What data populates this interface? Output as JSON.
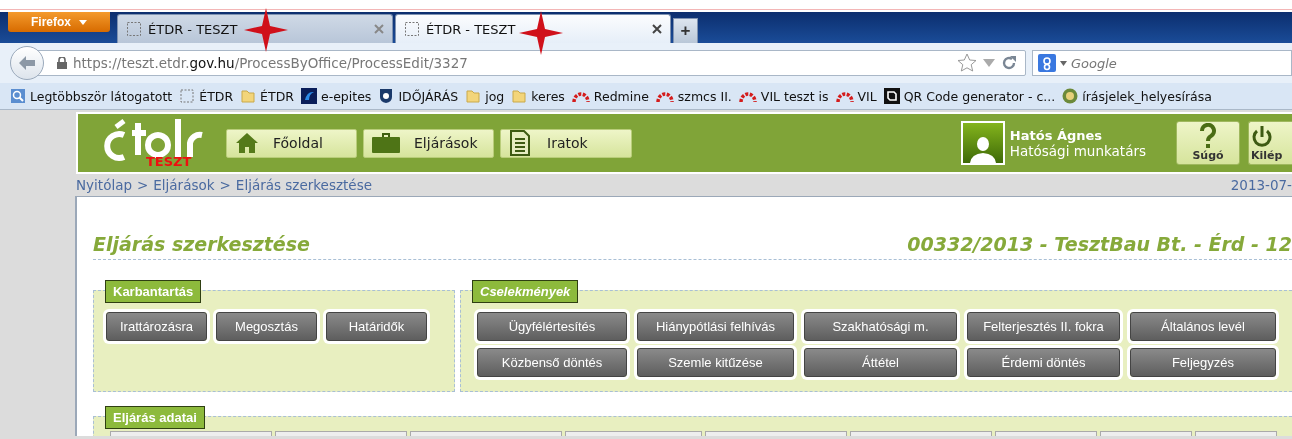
{
  "browser": {
    "menu_button": "Firefox",
    "tabs": [
      {
        "title": "ÉTDR - TESZT",
        "selected": false
      },
      {
        "title": "ÉTDR - TESZT",
        "selected": true
      }
    ],
    "new_tab": "+",
    "address": {
      "prefix": "https://teszt.etdr.",
      "domain": "gov.hu",
      "path": "/ProcessByOffice/ProcessEdit/3327"
    },
    "search": {
      "placeholder": "Google"
    },
    "bookmarks": [
      {
        "label": "Legtöbbször látogatott",
        "kind": "smart"
      },
      {
        "label": "ÉTDR",
        "kind": "page"
      },
      {
        "label": "ÉTDR",
        "kind": "folder"
      },
      {
        "label": "e-epites",
        "kind": "app"
      },
      {
        "label": "IDŐJÁRÁS",
        "kind": "shield"
      },
      {
        "label": "jog",
        "kind": "folder"
      },
      {
        "label": "keres",
        "kind": "folder"
      },
      {
        "label": "Redmine",
        "kind": "redmine"
      },
      {
        "label": "szmcs II.",
        "kind": "redmine"
      },
      {
        "label": "VIL teszt is",
        "kind": "redmine"
      },
      {
        "label": "VIL",
        "kind": "redmine"
      },
      {
        "label": "QR Code generator - c...",
        "kind": "qr"
      },
      {
        "label": "írásjelek_helyesírása",
        "kind": "emblem"
      }
    ]
  },
  "header": {
    "logo_badge": "TESZT",
    "nav": [
      {
        "label": "Főoldal",
        "kind": "home"
      },
      {
        "label": "Eljárások",
        "kind": "briefcase"
      },
      {
        "label": "Iratok",
        "kind": "document"
      }
    ],
    "user": {
      "name": "Hatós Ágnes",
      "role": "Hatósági munkatárs"
    },
    "actions": [
      {
        "label": "Súgó",
        "kind": "help"
      },
      {
        "label": "Kilép",
        "kind": "power"
      }
    ]
  },
  "breadcrumb": [
    {
      "label": "Nyitólap",
      "separator": ">"
    },
    {
      "label": "Eljárások",
      "separator": ">"
    },
    {
      "label": "Eljárás szerkesztése"
    }
  ],
  "date": "2013-07-",
  "page_title": "Eljárás szerkesztése",
  "case_title": "00332/2013 - TesztBau Bt. - Érd - 12",
  "panels": [
    {
      "legend": "Karbantartás",
      "buttons": [
        "Irattározásra",
        "Megosztás",
        "Határidők"
      ]
    },
    {
      "legend": "Cselekmények",
      "buttons": [
        "Ügyfélértesítés",
        "Hiánypótlási felhívás",
        "Szakhatósági m.",
        "Felterjesztés II. fokra",
        "Általános levél",
        "Közbenső döntés",
        "Szemle kitűzése",
        "Áttétel",
        "Érdemi döntés",
        "Feljegyzés"
      ]
    }
  ],
  "data_panel": {
    "legend": "Eljárás adatai"
  }
}
